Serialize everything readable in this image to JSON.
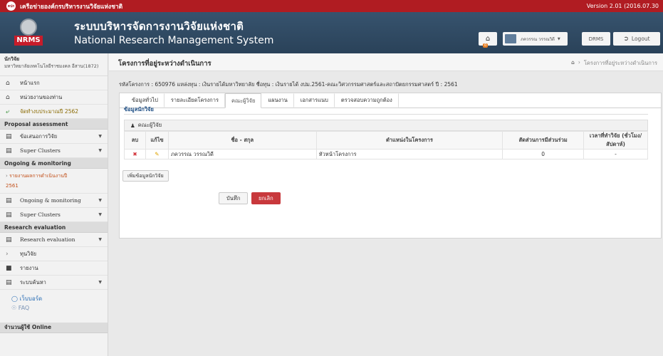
{
  "topbar": {
    "logo_text": "คปก",
    "network_title": "เครือข่ายองค์กรบริหารงานวิจัยแห่งชาติ",
    "version": "Version 2.01 (2016.07.30"
  },
  "header": {
    "logo_text": "NRMS",
    "system_thai": "ระบบบริหารจัดการงานวิจัยแห่งชาติ",
    "system_eng": "National Research Management System",
    "notification_count": "0",
    "user_name": "ภควรรณ วรรณวิดี",
    "drms_label": "DRMS",
    "logout_label": "Logout"
  },
  "sidebar": {
    "role": "นักวิจัย",
    "org": "มหาวิทยาลัยเทคโนโลยีราชมงคล อีสาน(1872)",
    "items": [
      {
        "label": "หน้าแรก",
        "icon": "home-icon"
      },
      {
        "label": "หน่วยงานของท่าน",
        "icon": "building-icon"
      },
      {
        "label": "จัดทำงบประมาณปี 2562",
        "icon": "arrow-icon"
      }
    ],
    "sections": {
      "proposal": "Proposal assessment",
      "ongoing": "Ongoing & monitoring",
      "research_eval": "Research evaluation",
      "online": "จำนวนผู้ใช้ Online"
    },
    "proposal_items": [
      "ข้อเสนอการวิจัย",
      "Super Clusters"
    ],
    "ongoing_sub": "รายงานผลการดำเนินงานปี",
    "ongoing_sub_year": "2561",
    "ongoing_items": [
      "Ongoing & monitoring",
      "Super Clusters"
    ],
    "eval_items": [
      "Research evaluation",
      "ทุนวิจัย",
      "รายงาน",
      "ระบบค้นหา"
    ],
    "links": [
      "เว็บบอร์ด",
      "FAQ"
    ]
  },
  "page": {
    "title": "โครงการที่อยู่ระหว่างดำเนินการ",
    "breadcrumb": "โครงการที่อยู่ระหว่างดำเนินการ",
    "project_info": "รหัสโครงการ : 650976 แหล่งทุน : เงินรายได้มหาวิทยาลัย ชื่อทุน : เงินรายได้ งปม.2561-คณะวิศวกรรมศาสตร์และสถาปัตยกรรมศาสตร์ ปี : 2561"
  },
  "tabs": [
    "ข้อมูลทั่วไป",
    "รายละเอียดโครงการ",
    "คณะผู้วิจัย",
    "แผนงาน",
    "เอกสารแนบ",
    "ตรวจสอบความถูกต้อง"
  ],
  "section_title": "ข้อมูลนักวิจัย",
  "table": {
    "caption": "คณะผู้วิจัย",
    "headers": [
      "ลบ",
      "แก้ไข",
      "ชื่อ - สกุล",
      "ตำแหน่งในโครงการ",
      "สัดส่วนการมีส่วนร่วม",
      "เวลาที่ทำวิจัย (ชั่วโมง/สัปดาห์)"
    ],
    "rows": [
      {
        "name": "ภควรรณ วรรณวิดี",
        "position": "หัวหน้าโครงการ",
        "ratio": "0",
        "time": "-"
      }
    ]
  },
  "buttons": {
    "add_researcher": "เพิ่มข้อมูลนักวิจัย",
    "save": "บันทึก",
    "cancel": "ยกเลิก"
  }
}
